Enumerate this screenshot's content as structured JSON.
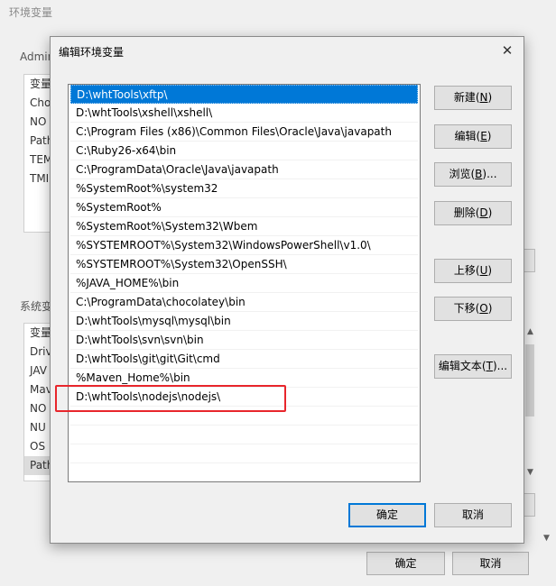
{
  "parent": {
    "title": "环境变量",
    "user_group_label": "Admin",
    "system_group_label": "系统变",
    "user_vars": [
      "变量",
      "Cho",
      "NO",
      "Path",
      "TEM",
      "TMI"
    ],
    "system_vars": [
      "变量",
      "Driv",
      "JAV",
      "Mav",
      "NO",
      "NU",
      "OS",
      "Path"
    ],
    "ok_label": "确定",
    "cancel_label": "取消"
  },
  "dialog": {
    "title": "编辑环境变量",
    "paths": [
      "D:\\whtTools\\xftp\\",
      "D:\\whtTools\\xshell\\xshell\\",
      "C:\\Program Files (x86)\\Common Files\\Oracle\\Java\\javapath",
      "C:\\Ruby26-x64\\bin",
      "C:\\ProgramData\\Oracle\\Java\\javapath",
      "%SystemRoot%\\system32",
      "%SystemRoot%",
      "%SystemRoot%\\System32\\Wbem",
      "%SYSTEMROOT%\\System32\\WindowsPowerShell\\v1.0\\",
      "%SYSTEMROOT%\\System32\\OpenSSH\\",
      "%JAVA_HOME%\\bin",
      "C:\\ProgramData\\chocolatey\\bin",
      "D:\\whtTools\\mysql\\mysql\\bin",
      "D:\\whtTools\\svn\\svn\\bin",
      "D:\\whtTools\\git\\git\\Git\\cmd",
      "%Maven_Home%\\bin",
      "D:\\whtTools\\nodejs\\nodejs\\"
    ],
    "selected_index": 0,
    "buttons": {
      "new": {
        "label": "新建(",
        "key": "N",
        "end": ")"
      },
      "edit": {
        "label": "编辑(",
        "key": "E",
        "end": ")"
      },
      "browse": {
        "label": "浏览(",
        "key": "B",
        "end": ")..."
      },
      "delete": {
        "label": "删除(",
        "key": "D",
        "end": ")"
      },
      "move_up": {
        "label": "上移(",
        "key": "U",
        "end": ")"
      },
      "move_down": {
        "label": "下移(",
        "key": "O",
        "end": ")"
      },
      "edit_text": {
        "label": "编辑文本(",
        "key": "T",
        "end": ")..."
      }
    },
    "ok_label": "确定",
    "cancel_label": "取消",
    "close_glyph": "✕"
  },
  "colors": {
    "selection": "#0078d7",
    "highlight_box": "#e8262c"
  }
}
